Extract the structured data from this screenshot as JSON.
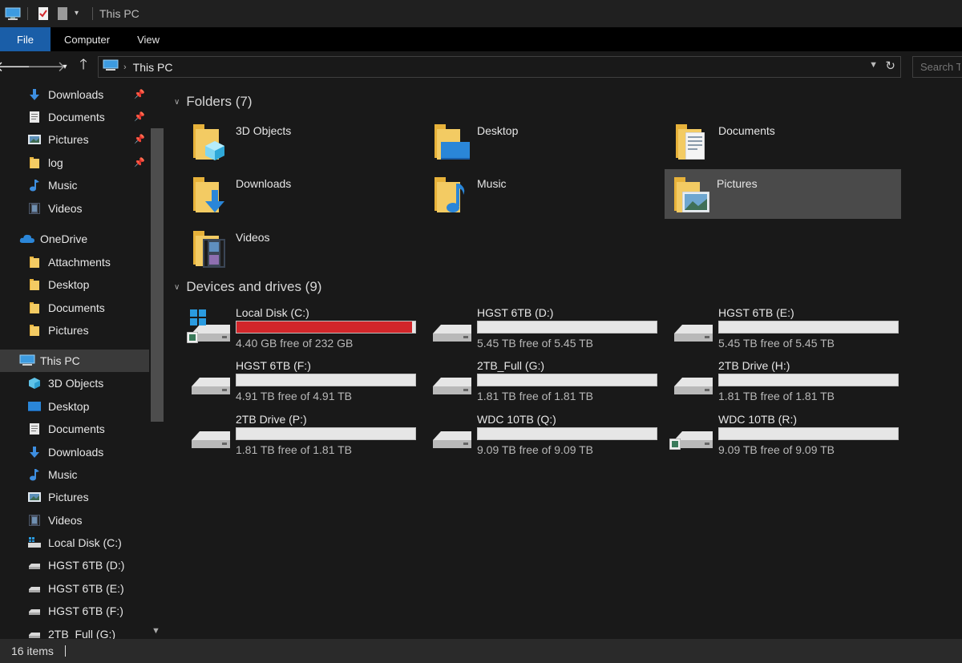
{
  "window": {
    "title": "This PC"
  },
  "ribbon": {
    "tabs": [
      "File",
      "Computer",
      "View"
    ]
  },
  "address": {
    "location": "This PC",
    "search_placeholder": "Search T"
  },
  "sidebar": {
    "quick_access": [
      {
        "label": "Downloads",
        "icon": "download-arrow-icon",
        "pinned": true
      },
      {
        "label": "Documents",
        "icon": "document-icon",
        "pinned": true
      },
      {
        "label": "Pictures",
        "icon": "pictures-icon",
        "pinned": true
      },
      {
        "label": "log",
        "icon": "folder-icon",
        "pinned": true
      },
      {
        "label": "Music",
        "icon": "music-note-icon",
        "pinned": false
      },
      {
        "label": "Videos",
        "icon": "videos-icon",
        "pinned": false
      }
    ],
    "onedrive": {
      "label": "OneDrive",
      "items": [
        "Attachments",
        "Desktop",
        "Documents",
        "Pictures"
      ]
    },
    "this_pc": {
      "label": "This PC",
      "items": [
        {
          "label": "3D Objects",
          "icon": "3d-objects-icon"
        },
        {
          "label": "Desktop",
          "icon": "desktop-icon"
        },
        {
          "label": "Documents",
          "icon": "document-icon"
        },
        {
          "label": "Downloads",
          "icon": "download-arrow-icon"
        },
        {
          "label": "Music",
          "icon": "music-note-icon"
        },
        {
          "label": "Pictures",
          "icon": "pictures-icon"
        },
        {
          "label": "Videos",
          "icon": "videos-icon"
        },
        {
          "label": "Local Disk (C:)",
          "icon": "system-drive-icon"
        },
        {
          "label": "HGST 6TB (D:)",
          "icon": "drive-icon"
        },
        {
          "label": "HGST 6TB (E:)",
          "icon": "drive-icon"
        },
        {
          "label": "HGST 6TB (F:)",
          "icon": "drive-icon"
        },
        {
          "label": "2TB_Full (G:)",
          "icon": "drive-icon"
        }
      ]
    }
  },
  "folders_section": {
    "title": "Folders (7)",
    "items": [
      {
        "label": "3D Objects",
        "badge": "3d-cube-icon"
      },
      {
        "label": "Desktop",
        "badge": "desktop-screen-icon"
      },
      {
        "label": "Documents",
        "badge": "document-page-icon"
      },
      {
        "label": "Downloads",
        "badge": "download-arrow-icon"
      },
      {
        "label": "Music",
        "badge": "music-note-icon"
      },
      {
        "label": "Pictures",
        "badge": "landscape-picture-icon",
        "selected": true
      },
      {
        "label": "Videos",
        "badge": "film-strip-icon"
      }
    ]
  },
  "drives_section": {
    "title": "Devices and drives (9)",
    "items": [
      {
        "name": "Local Disk (C:)",
        "free": "4.40 GB free of 232 GB",
        "used_fraction": 0.981,
        "bar_color": "#d2262a",
        "system": true
      },
      {
        "name": "HGST 6TB (D:)",
        "free": "5.45 TB free of 5.45 TB",
        "used_fraction": 0
      },
      {
        "name": "HGST 6TB (E:)",
        "free": "5.45 TB free of 5.45 TB",
        "used_fraction": 0
      },
      {
        "name": "HGST 6TB (F:)",
        "free": "4.91 TB free of 4.91 TB",
        "used_fraction": 0
      },
      {
        "name": "2TB_Full (G:)",
        "free": "1.81 TB free of 1.81 TB",
        "used_fraction": 0
      },
      {
        "name": "2TB Drive (H:)",
        "free": "1.81 TB free of 1.81 TB",
        "used_fraction": 0
      },
      {
        "name": "2TB Drive (P:)",
        "free": "1.81 TB free of 1.81 TB",
        "used_fraction": 0
      },
      {
        "name": "WDC 10TB (Q:)",
        "free": "9.09 TB free of 9.09 TB",
        "used_fraction": 0
      },
      {
        "name": "WDC 10TB (R:)",
        "free": "9.09 TB free of 9.09 TB",
        "used_fraction": 0,
        "shared": true
      }
    ]
  },
  "status": {
    "items_count": "16 items"
  },
  "colors": {
    "accent": "#1a5ea8",
    "folder": "#f3cb63",
    "drive_full": "#d2262a",
    "background": "#191919"
  }
}
